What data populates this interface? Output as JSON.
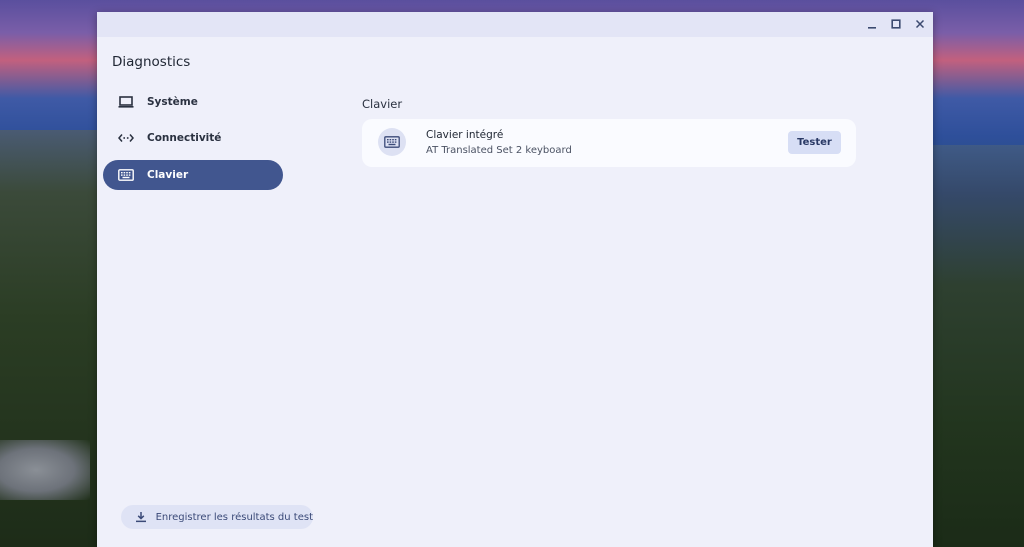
{
  "window": {
    "controls": [
      {
        "name": "minimize",
        "icon": "minimize-icon"
      },
      {
        "name": "maximize",
        "icon": "maximize-icon"
      },
      {
        "name": "close",
        "icon": "close-icon"
      }
    ]
  },
  "app": {
    "title": "Diagnostics"
  },
  "sidebar": {
    "items": [
      {
        "label": "Système",
        "icon": "laptop-icon",
        "active": false
      },
      {
        "label": "Connectivité",
        "icon": "connectivity-icon",
        "active": false
      },
      {
        "label": "Clavier",
        "icon": "keyboard-icon",
        "active": true
      }
    ],
    "save_button_label": "Enregistrer les résultats du test",
    "save_icon": "download-icon"
  },
  "main": {
    "section_title": "Clavier",
    "card": {
      "icon": "keyboard-icon",
      "title": "Clavier intégré",
      "subtitle": "AT Translated Set 2 keyboard",
      "button_label": "Tester"
    }
  },
  "colors": {
    "window_bg": "#eff0fa",
    "active_nav": "#41568f",
    "button_bg": "#d7def5"
  }
}
